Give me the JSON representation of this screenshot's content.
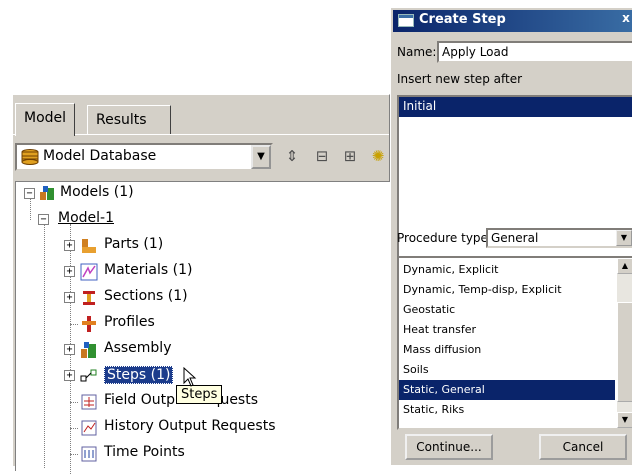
{
  "tree_panel": {
    "tabs": [
      "Model",
      "Results"
    ],
    "database_select": "Model Database",
    "tree": {
      "root": "Models (1)",
      "model": "Model-1",
      "children": [
        "Parts (1)",
        "Materials (1)",
        "Sections (1)",
        "Profiles",
        "Assembly",
        "Steps (1)",
        "Field Output Requests",
        "History Output Requests",
        "Time Points"
      ]
    },
    "tooltip": "Steps"
  },
  "dialog": {
    "title": "Create Step",
    "close_label": "x",
    "name_label": "Name:",
    "name_value": "Apply Load",
    "insert_label": "Insert new step after",
    "steps": [
      "Initial"
    ],
    "procedure_label": "Procedure type:",
    "procedure_value": "General",
    "procedures": [
      "Dynamic, Explicit",
      "Dynamic, Temp-disp, Explicit",
      "Geostatic",
      "Heat transfer",
      "Mass diffusion",
      "Soils",
      "Static, General",
      "Static, Riks"
    ],
    "selected_procedure": "Static, General",
    "continue_label": "Continue...",
    "cancel_label": "Cancel"
  },
  "colors": {
    "selection": "#0a246a",
    "panel": "#d4d0c8",
    "titlebar": "#0a246a"
  }
}
